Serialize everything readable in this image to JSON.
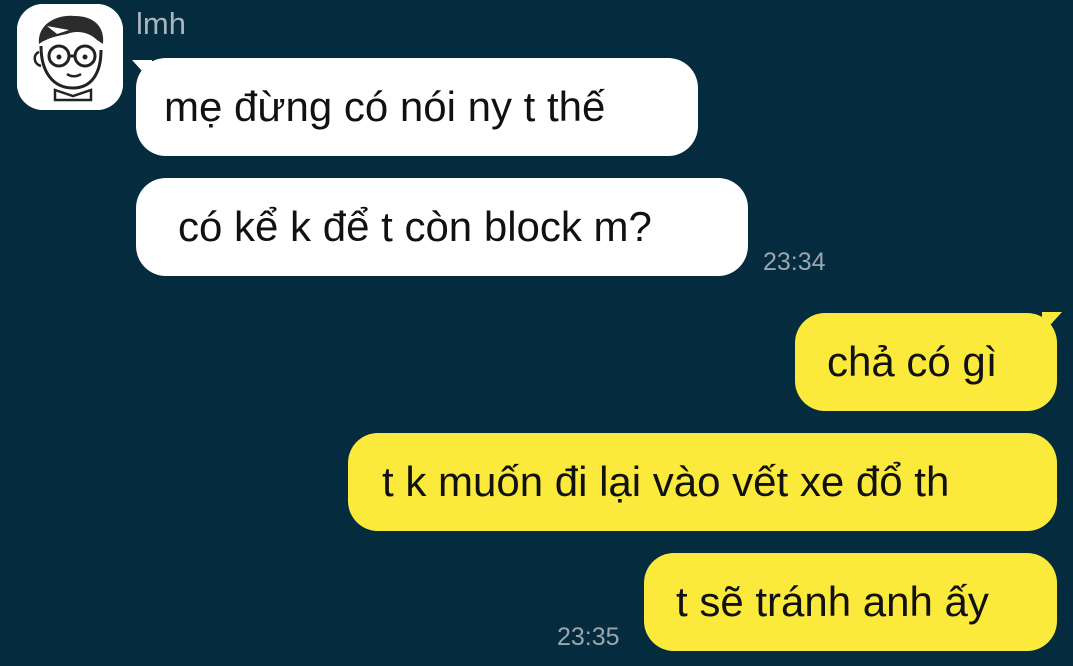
{
  "chat": {
    "sender_name": "lmh",
    "avatar_icon": "cartoon-face-with-glasses-avatar-icon",
    "colors": {
      "background": "#052b3f",
      "incoming_bubble": "#ffffff",
      "outgoing_bubble": "#fbea3b",
      "timestamp": "#9aa5ad"
    },
    "incoming": [
      {
        "text": "mẹ đừng có nói ny t thế"
      },
      {
        "text": "có kể k để t còn block m?"
      }
    ],
    "incoming_time": "23:34",
    "outgoing": [
      {
        "text": "chả có gì"
      },
      {
        "text": "t k muốn đi lại vào vết xe đổ th"
      },
      {
        "text": "t sẽ tránh anh ấy"
      }
    ],
    "outgoing_time": "23:35"
  }
}
